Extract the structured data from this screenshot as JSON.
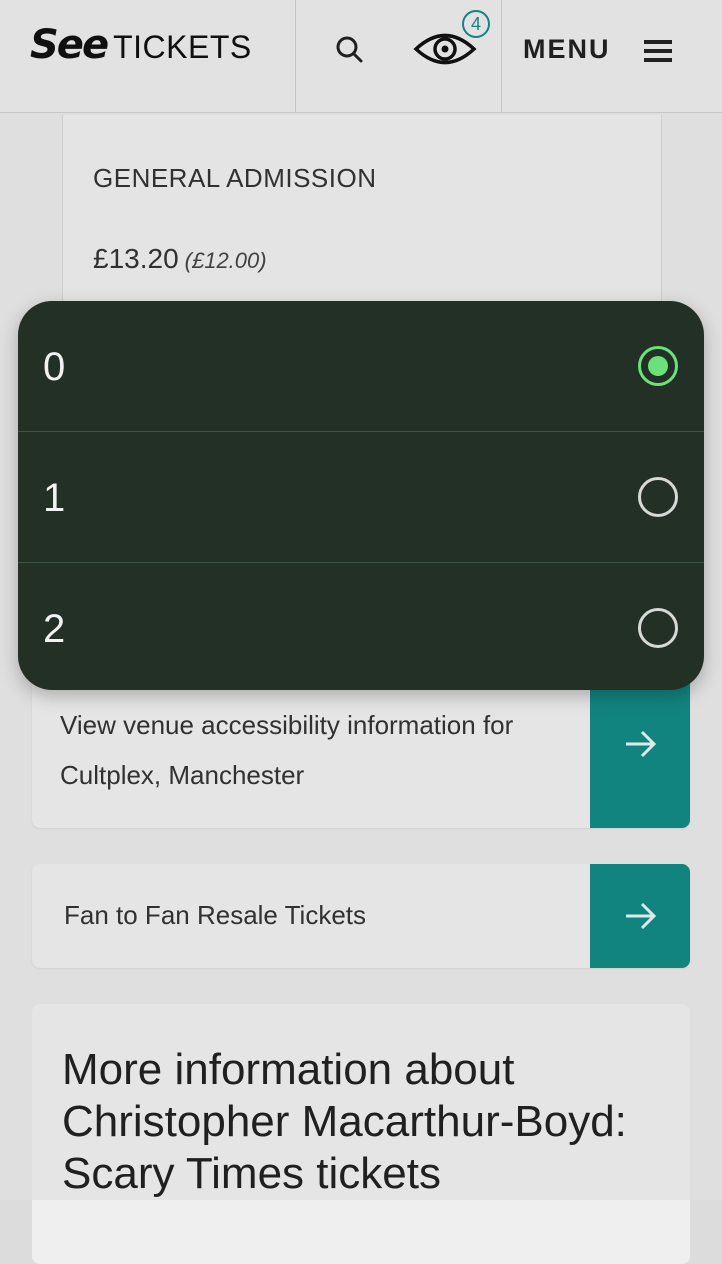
{
  "header": {
    "logo_see": "See",
    "logo_tickets": "TICKETS",
    "search_icon": "search-icon",
    "watchlist_icon": "eye-icon",
    "watchlist_count": "4",
    "menu_label": "MENU",
    "menu_icon": "hamburger-icon"
  },
  "ticket": {
    "type": "GENERAL ADMISSION",
    "price": "£13.20",
    "base_price": "(£12.00)"
  },
  "links": {
    "accessibility": "View venue accessibility information for Cultplex, Manchester",
    "resale": "Fan to Fan Resale Tickets",
    "arrow_icon": "arrow-right-icon"
  },
  "info": {
    "title": "More information about Christopher Macarthur-Boyd: Scary Times tickets"
  },
  "quantity_picker": {
    "options": [
      {
        "label": "0",
        "selected": true
      },
      {
        "label": "1",
        "selected": false
      },
      {
        "label": "2",
        "selected": false
      }
    ]
  },
  "colors": {
    "accent": "#138a86",
    "picker_bg": "#223026",
    "radio_selected": "#6ce07a"
  }
}
